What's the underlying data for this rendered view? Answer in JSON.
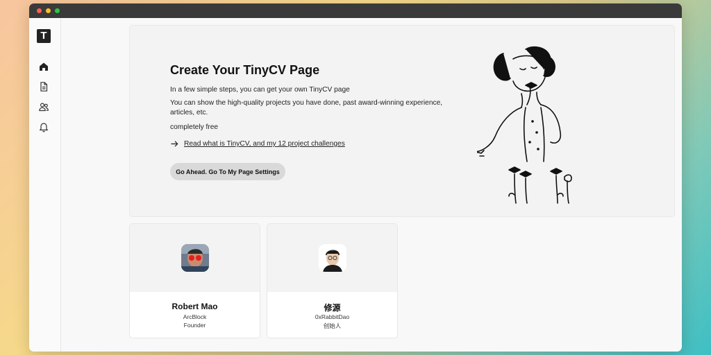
{
  "window": {
    "controls": [
      "close",
      "minimize",
      "maximize"
    ]
  },
  "sidebar": {
    "logo_letter": "T",
    "items": [
      {
        "name": "home",
        "icon": "home-icon"
      },
      {
        "name": "document",
        "icon": "document-icon"
      },
      {
        "name": "users",
        "icon": "users-icon"
      },
      {
        "name": "notifications",
        "icon": "bell-icon"
      }
    ]
  },
  "hero": {
    "title": "Create Your TinyCV Page",
    "line1": "In a few simple steps, you can get your own TinyCV page",
    "line2": "You can show the high-quality projects you have done, past award-winning experience, articles, etc.",
    "line3": "completely free",
    "link_text": "Read what is TinyCV, and my 12 project challenges",
    "link_icon": "arrow-right-icon",
    "button_label": "Go Ahead. Go To My Page Settings"
  },
  "profiles": [
    {
      "name": "Robert Mao",
      "org": "ArcBlock",
      "role": "Founder"
    },
    {
      "name": "修源",
      "org": "0xRabbitDao",
      "role": "创始人"
    }
  ],
  "colors": {
    "sidebar_logo": "#222222",
    "button_bg": "#d9d9d9",
    "hero_bg": "#f3f3f3"
  }
}
